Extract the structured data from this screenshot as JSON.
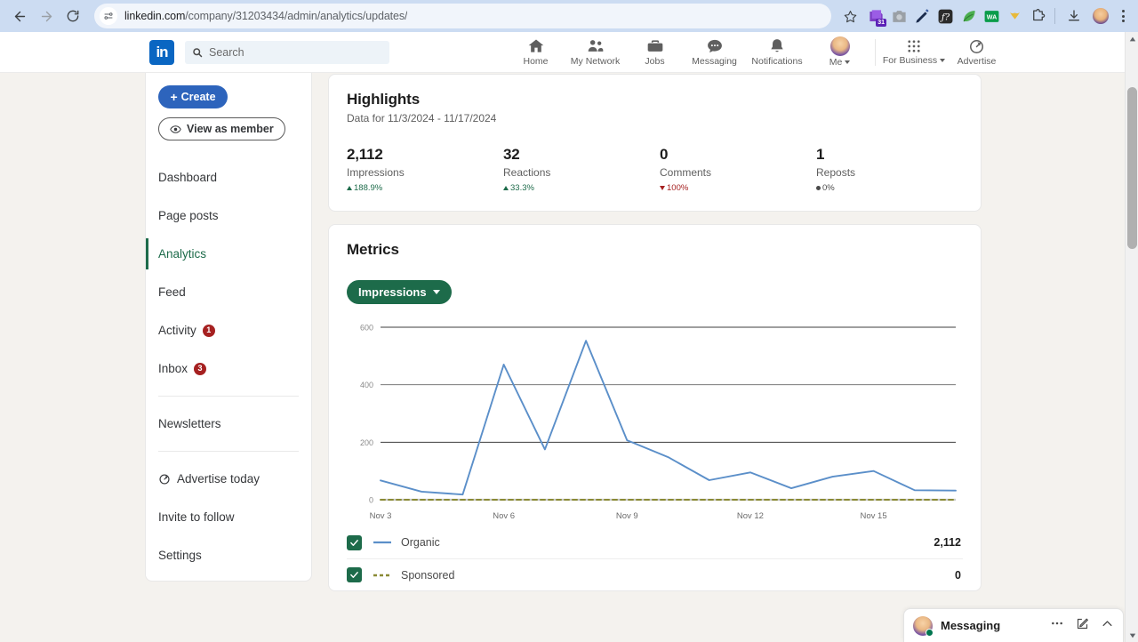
{
  "browser": {
    "url_domain": "linkedin.com",
    "url_path": "/company/31203434/admin/analytics/updates/",
    "back_icon": "back-arrow-icon",
    "forward_icon": "forward-arrow-icon",
    "reload_icon": "reload-icon",
    "site_info_icon": "site-settings-icon",
    "bookmark_icon": "star-icon",
    "download_icon": "download-icon",
    "menu_icon": "kebab-menu-icon",
    "extensions": [
      {
        "name": "calendar-extension-icon",
        "badge": "31"
      },
      {
        "name": "camera-extension-icon",
        "badge": ""
      },
      {
        "name": "pen-extension-icon",
        "badge": ""
      },
      {
        "name": "formula-extension-icon",
        "badge": ""
      },
      {
        "name": "leaf-extension-icon",
        "badge": ""
      },
      {
        "name": "wa-extension-icon",
        "badge": "WA"
      },
      {
        "name": "honey-extension-icon",
        "badge": ""
      },
      {
        "name": "puzzle-extensions-icon",
        "badge": ""
      }
    ]
  },
  "topnav": {
    "logo": "in",
    "search_placeholder": "Search",
    "search_icon": "search-icon",
    "items": [
      {
        "label": "Home",
        "icon": "home-icon"
      },
      {
        "label": "My Network",
        "icon": "network-icon"
      },
      {
        "label": "Jobs",
        "icon": "briefcase-icon"
      },
      {
        "label": "Messaging",
        "icon": "message-bubble-icon"
      },
      {
        "label": "Notifications",
        "icon": "bell-icon"
      },
      {
        "label": "Me",
        "icon": "avatar-icon",
        "has_caret": true
      }
    ],
    "right_items": [
      {
        "label": "For Business",
        "icon": "grid-apps-icon",
        "has_caret": true
      },
      {
        "label": "Advertise",
        "icon": "advertise-icon"
      }
    ]
  },
  "sidebar": {
    "create_label": "Create",
    "create_icon": "plus-icon",
    "view_as_member_label": "View as member",
    "view_as_member_icon": "eye-icon",
    "items": [
      {
        "label": "Dashboard",
        "badge": "",
        "active": false
      },
      {
        "label": "Page posts",
        "badge": "",
        "active": false
      },
      {
        "label": "Analytics",
        "badge": "",
        "active": true
      },
      {
        "label": "Feed",
        "badge": "",
        "active": false
      },
      {
        "label": "Activity",
        "badge": "1",
        "active": false
      },
      {
        "label": "Inbox",
        "badge": "3",
        "active": false
      }
    ],
    "newsletters_label": "Newsletters",
    "advertise_label": "Advertise today",
    "advertise_icon": "advertise-icon",
    "invite_label": "Invite to follow",
    "settings_label": "Settings"
  },
  "highlights": {
    "title": "Highlights",
    "subtitle": "Data for 11/3/2024 - 11/17/2024",
    "stats": [
      {
        "value": "2,112",
        "label": "Impressions",
        "delta": "188.9%",
        "direction": "up"
      },
      {
        "value": "32",
        "label": "Reactions",
        "delta": "33.3%",
        "direction": "up"
      },
      {
        "value": "0",
        "label": "Comments",
        "delta": "100%",
        "direction": "down"
      },
      {
        "value": "1",
        "label": "Reposts",
        "delta": "0%",
        "direction": "flat"
      }
    ]
  },
  "metrics": {
    "title": "Metrics",
    "selected_metric": "Impressions",
    "dropdown_icon": "chevron-down-icon",
    "legend": [
      {
        "name": "Organic",
        "value": "2,112",
        "checked": true,
        "style": "solid",
        "color": "#5b8fc9"
      },
      {
        "name": "Sponsored",
        "value": "0",
        "checked": true,
        "style": "dashed",
        "color": "#8a8a35"
      }
    ]
  },
  "chart_data": {
    "type": "line",
    "title": "Impressions",
    "xlabel": "",
    "ylabel": "",
    "ylim": [
      0,
      600
    ],
    "yticks": [
      0,
      200,
      400,
      600
    ],
    "grid": true,
    "legend_position": "bottom",
    "x": [
      "Nov 3",
      "Nov 4",
      "Nov 5",
      "Nov 6",
      "Nov 7",
      "Nov 8",
      "Nov 9",
      "Nov 10",
      "Nov 11",
      "Nov 12",
      "Nov 13",
      "Nov 14",
      "Nov 15",
      "Nov 16",
      "Nov 17"
    ],
    "xtick_labels": [
      "Nov 3",
      "Nov 6",
      "Nov 9",
      "Nov 12",
      "Nov 15"
    ],
    "xtick_indices": [
      0,
      3,
      6,
      9,
      12
    ],
    "series": [
      {
        "name": "Organic",
        "color": "#5b8fc9",
        "style": "solid",
        "total": 2112,
        "values": [
          67,
          28,
          18,
          470,
          175,
          553,
          207,
          148,
          68,
          95,
          40,
          80,
          100,
          33,
          32
        ]
      },
      {
        "name": "Sponsored",
        "color": "#8a8a35",
        "style": "dashed",
        "total": 0,
        "values": [
          0,
          0,
          0,
          0,
          0,
          0,
          0,
          0,
          0,
          0,
          0,
          0,
          0,
          0,
          0
        ]
      }
    ]
  },
  "messaging": {
    "title": "Messaging",
    "more_icon": "ellipsis-icon",
    "compose_icon": "compose-icon",
    "expand_icon": "chevron-up-icon"
  }
}
